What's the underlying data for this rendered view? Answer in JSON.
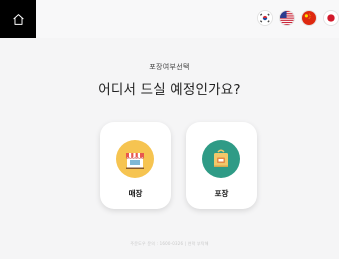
{
  "header": {
    "home_icon": "home-icon",
    "languages": [
      {
        "name": "korean-flag-icon"
      },
      {
        "name": "us-flag-icon"
      },
      {
        "name": "china-flag-icon"
      },
      {
        "name": "japan-flag-icon"
      }
    ]
  },
  "main": {
    "subtitle": "포장여부선택",
    "title": "어디서 드실 예정인가요?",
    "options": [
      {
        "label": "매장",
        "icon": "store-icon",
        "color": "#f6c451"
      },
      {
        "label": "포장",
        "icon": "takeout-bag-icon",
        "color": "#2f9b86"
      }
    ]
  },
  "footer": {
    "text": "주문도우 문의 : 1600-0326 | 연락 부탁해"
  },
  "colors": {
    "home_button_bg": "#000000",
    "page_bg": "#f5f5f6"
  }
}
